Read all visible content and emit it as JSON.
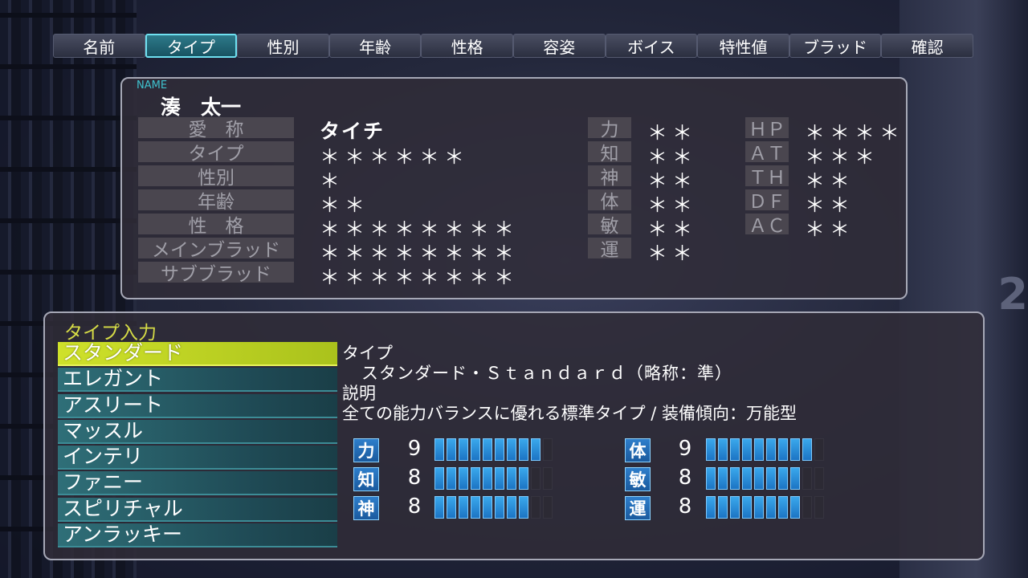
{
  "tabs": [
    "名前",
    "タイプ",
    "性別",
    "年齢",
    "性格",
    "容姿",
    "ボイス",
    "特性値",
    "ブラッド",
    "確認"
  ],
  "active_tab": 1,
  "background_number": "2",
  "profile": {
    "name_caption": "NAME",
    "name": "湊　太一",
    "rows": [
      {
        "label": "愛　称",
        "value": "タイチ"
      },
      {
        "label": "タイプ",
        "value": "＊＊＊＊＊＊"
      },
      {
        "label": "性別",
        "value": "＊"
      },
      {
        "label": "年齢",
        "value": "＊＊"
      },
      {
        "label": "性　格",
        "value": "＊＊＊＊＊＊＊＊"
      },
      {
        "label": "メインブラッド",
        "value": "＊＊＊＊＊＊＊＊"
      },
      {
        "label": "サブブラッド",
        "value": "＊＊＊＊＊＊＊＊"
      }
    ],
    "stats": [
      {
        "label": "力",
        "value": "＊＊"
      },
      {
        "label": "知",
        "value": "＊＊"
      },
      {
        "label": "神",
        "value": "＊＊"
      },
      {
        "label": "体",
        "value": "＊＊"
      },
      {
        "label": "敏",
        "value": "＊＊"
      },
      {
        "label": "運",
        "value": "＊＊"
      }
    ],
    "combat": [
      {
        "label": "ＨＰ",
        "value": "＊＊＊＊"
      },
      {
        "label": "ＡＴ",
        "value": "＊＊＊"
      },
      {
        "label": "ＴＨ",
        "value": "＊＊"
      },
      {
        "label": "ＤＦ",
        "value": "＊＊"
      },
      {
        "label": "ＡＣ",
        "value": "＊＊"
      }
    ]
  },
  "type_input": {
    "title": "タイプ入力",
    "items": [
      "スタンダード",
      "エレガント",
      "アスリート",
      "マッスル",
      "インテリ",
      "ファニー",
      "スピリチャル",
      "アンラッキー"
    ],
    "selected": 0
  },
  "info": {
    "type_heading": "タイプ",
    "type_value": "スタンダード・Ｓｔａｎｄａｒｄ（略称：準）",
    "desc_heading": "説明",
    "desc_value": "全ての能力バランスに優れる標準タイプ / 装備傾向：万能型"
  },
  "bars_max": 10,
  "bars": [
    {
      "label": "力",
      "value": "9",
      "level": 9
    },
    {
      "label": "知",
      "value": "8",
      "level": 8
    },
    {
      "label": "神",
      "value": "8",
      "level": 8
    },
    {
      "label": "体",
      "value": "9",
      "level": 9
    },
    {
      "label": "敏",
      "value": "8",
      "level": 8
    },
    {
      "label": "運",
      "value": "8",
      "level": 8
    }
  ],
  "colors": {
    "accent": "#6fe0f0",
    "selected": "#c4d82a",
    "bar": "#2a8ee0"
  }
}
